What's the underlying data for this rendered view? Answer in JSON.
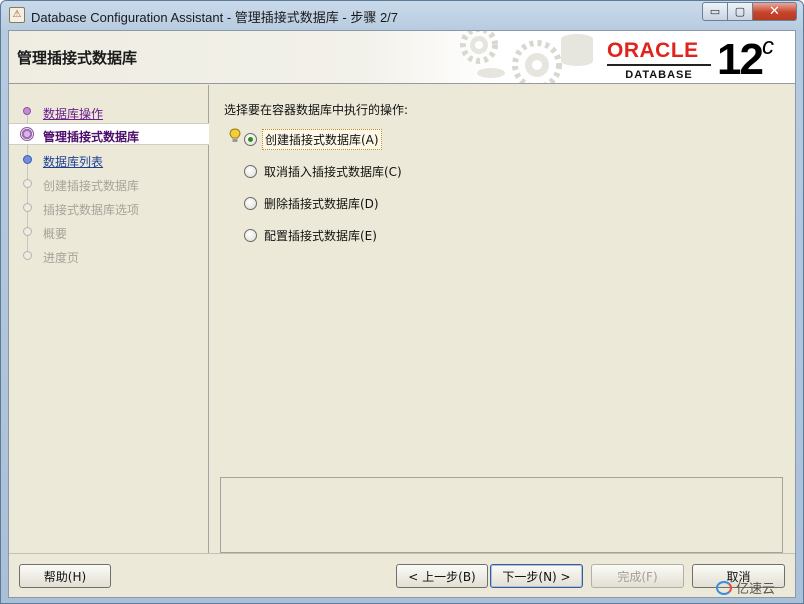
{
  "window": {
    "title": "Database Configuration Assistant - 管理插接式数据库 - 步骤 2/7",
    "icon_glyph": "⚠",
    "minimize_glyph": "▭",
    "maximize_glyph": "▢",
    "close_glyph": "✕"
  },
  "header": {
    "title": "管理插接式数据库",
    "brand": "ORACLE",
    "brand_sub": "DATABASE",
    "version": "12",
    "version_suffix": "c",
    "brand_color": "#e0231c"
  },
  "nav": {
    "items": [
      {
        "label": "数据库操作",
        "state": "done"
      },
      {
        "label": "管理插接式数据库",
        "state": "current"
      },
      {
        "label": "数据库列表",
        "state": "link"
      },
      {
        "label": "创建插接式数据库",
        "state": "disabled"
      },
      {
        "label": "插接式数据库选项",
        "state": "disabled"
      },
      {
        "label": "概要",
        "state": "disabled"
      },
      {
        "label": "进度页",
        "state": "disabled"
      }
    ]
  },
  "main": {
    "prompt": "选择要在容器数据库中执行的操作:",
    "hint_icon": "lightbulb-icon",
    "options": [
      {
        "label": "创建插接式数据库(A)",
        "checked": true
      },
      {
        "label": "取消插入插接式数据库(C)",
        "checked": false
      },
      {
        "label": "删除插接式数据库(D)",
        "checked": false
      },
      {
        "label": "配置插接式数据库(E)",
        "checked": false
      }
    ]
  },
  "footer": {
    "help": "帮助(H)",
    "back": "< 上一步(B)",
    "next": "下一步(N) >",
    "finish": "完成(F)",
    "cancel": "取消"
  },
  "watermark": "亿速云"
}
